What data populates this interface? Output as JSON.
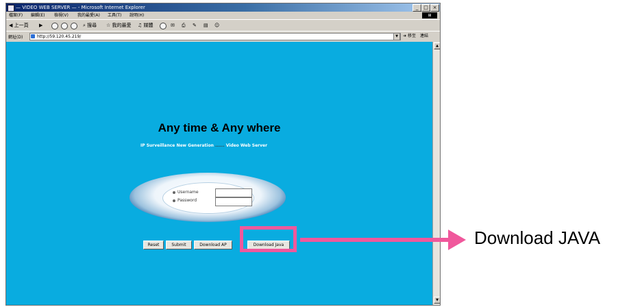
{
  "window": {
    "title": "— VIDEO WEB SERVER — - Microsoft Internet Explorer",
    "controls": {
      "minimize": "_",
      "maximize": "□",
      "close": "×"
    }
  },
  "menubar": {
    "items": [
      "檔案(F)",
      "編輯(E)",
      "檢視(V)",
      "我的最愛(A)",
      "工具(T)",
      "說明(H)"
    ]
  },
  "toolbar": {
    "back_label": "上一頁",
    "search_label": "搜尋",
    "favorites_label": "我的最愛",
    "media_label": "媒體"
  },
  "address_bar": {
    "label": "網址(D)",
    "url": "http://59.120.45.219/",
    "go_label": "移至",
    "links_label": "連結"
  },
  "page": {
    "headline": "Any time & Any where",
    "tagline_left": "IP Surveillance New Generation",
    "tagline_sep": "......",
    "tagline_right": "Video Web Server",
    "login": {
      "username_label": "Username",
      "password_label": "Password",
      "username_value": "",
      "password_value": ""
    },
    "buttons": {
      "reset": "Reset",
      "submit": "Submit",
      "download_ap": "Download AP",
      "download_java": "Download Java"
    }
  },
  "callout": {
    "label": "Download JAVA",
    "color": "#f0589c"
  },
  "colors": {
    "page_background": "#09ace0",
    "titlebar": "#0a246a"
  }
}
